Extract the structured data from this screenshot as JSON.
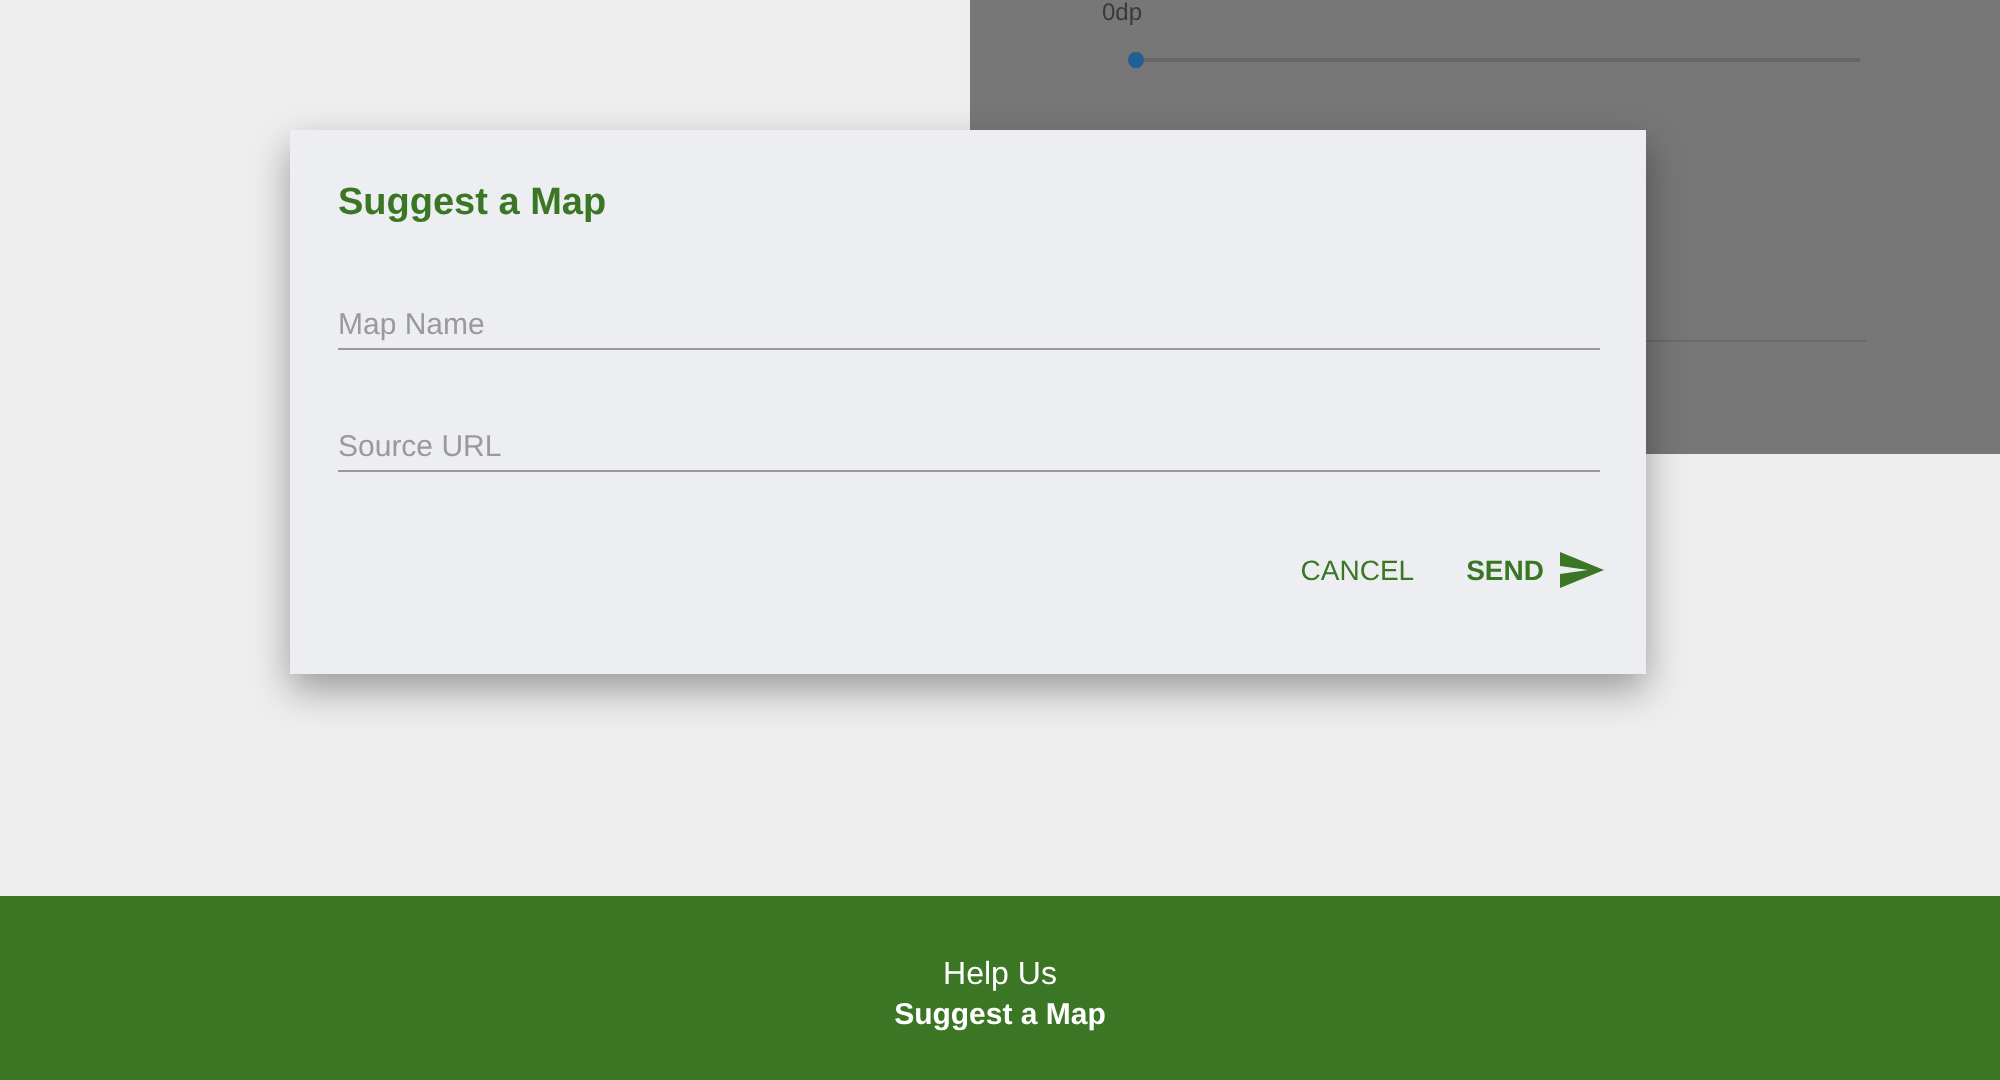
{
  "background_panel": {
    "slider_label": "0dp",
    "slider": {
      "level": 0
    }
  },
  "dialog": {
    "title": "Suggest a Map",
    "fields": [
      {
        "placeholder": "Map Name"
      },
      {
        "placeholder": "Source URL"
      }
    ],
    "buttons": [
      {
        "label": "CANCEL",
        "kind": "text"
      },
      {
        "label": "SEND",
        "kind": "send"
      }
    ]
  },
  "footer": {
    "line_1": "Help Us",
    "line_2": "Suggest a Map"
  }
}
